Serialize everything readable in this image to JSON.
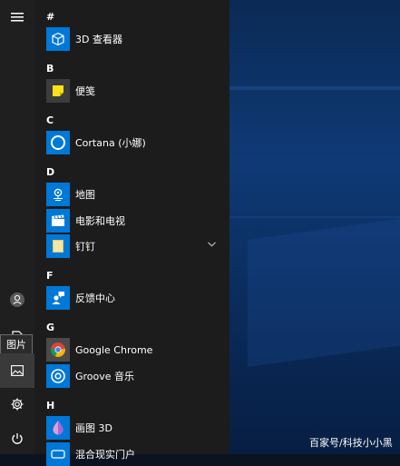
{
  "rail": {
    "tooltip": "图片"
  },
  "sections": {
    "hash": "#",
    "b": "B",
    "c": "C",
    "d": "D",
    "f": "F",
    "g": "G",
    "h": "H"
  },
  "apps": {
    "viewer3d": "3D 查看器",
    "sticky": "便笺",
    "cortana": "Cortana (小娜)",
    "maps": "地图",
    "movies": "电影和电视",
    "pin": "钉钉",
    "feedback": "反馈中心",
    "chrome": "Google Chrome",
    "groove": "Groove 音乐",
    "paint3d": "画图 3D",
    "mixed": "混合现实门户"
  },
  "watermark": "百家号/科技小小黑",
  "colors": {
    "tile_blue": "#0078d7",
    "sticky_gray": "#3c3c3c",
    "sticky_yellow": "#ffe11a",
    "chrome_gray": "#4a4a4a"
  }
}
